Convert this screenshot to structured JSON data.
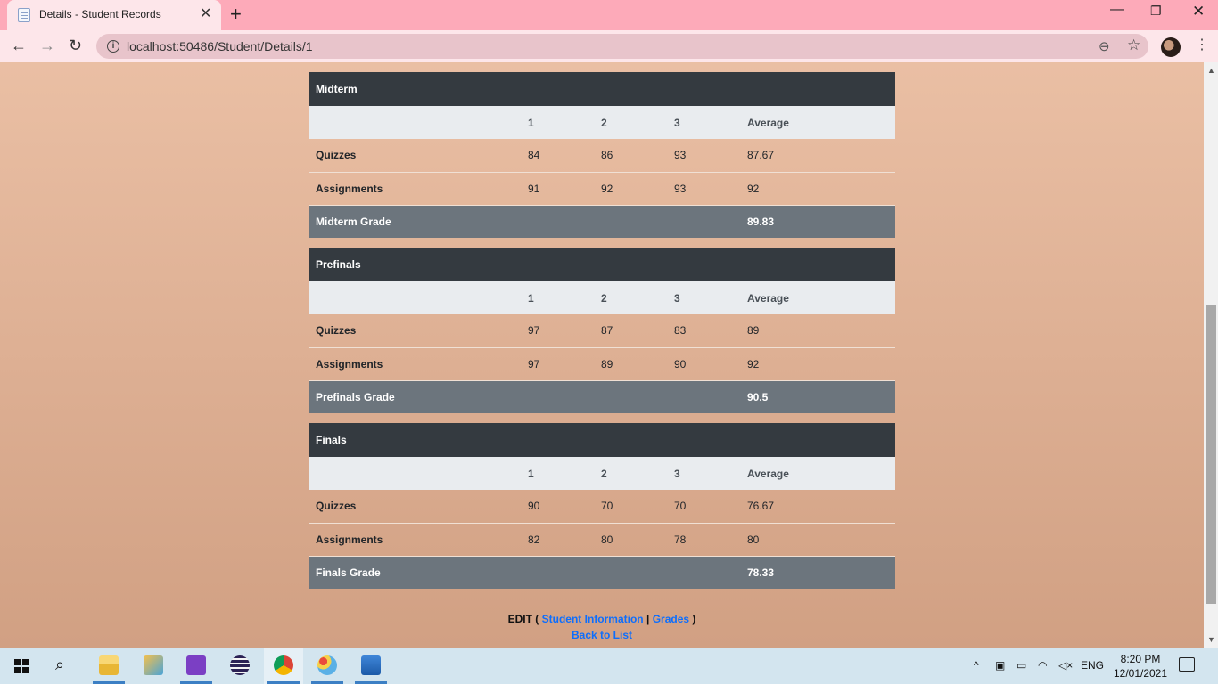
{
  "browser": {
    "tab_title": "Details - Student Records",
    "tab_close": "✕",
    "new_tab": "+",
    "url": "localhost:50486/Student/Details/1",
    "win_minimize": "—",
    "win_restore": "❐",
    "win_close": "✕",
    "back": "←",
    "forward": "→",
    "reload": "↻",
    "info": "i",
    "zoom": "⊖",
    "bookmark": "☆",
    "menu": "⋮"
  },
  "tables": [
    {
      "title": "Midterm",
      "columns": [
        "",
        "1",
        "2",
        "3",
        "Average"
      ],
      "rows": [
        {
          "label": "Quizzes",
          "values": [
            "84",
            "86",
            "93",
            "87.67"
          ]
        },
        {
          "label": "Assignments",
          "values": [
            "91",
            "92",
            "93",
            "92"
          ]
        }
      ],
      "footer_label": "Midterm Grade",
      "footer_value": "89.83"
    },
    {
      "title": "Prefinals",
      "columns": [
        "",
        "1",
        "2",
        "3",
        "Average"
      ],
      "rows": [
        {
          "label": "Quizzes",
          "values": [
            "97",
            "87",
            "83",
            "89"
          ]
        },
        {
          "label": "Assignments",
          "values": [
            "97",
            "89",
            "90",
            "92"
          ]
        }
      ],
      "footer_label": "Prefinals Grade",
      "footer_value": "90.5"
    },
    {
      "title": "Finals",
      "columns": [
        "",
        "1",
        "2",
        "3",
        "Average"
      ],
      "rows": [
        {
          "label": "Quizzes",
          "values": [
            "90",
            "70",
            "70",
            "76.67"
          ]
        },
        {
          "label": "Assignments",
          "values": [
            "82",
            "80",
            "78",
            "80"
          ]
        }
      ],
      "footer_label": "Finals Grade",
      "footer_value": "78.33"
    }
  ],
  "links": {
    "edit_label": "EDIT",
    "open_paren": "(",
    "student_info": "Student Information",
    "separator": "|",
    "grades": "Grades",
    "close_paren": ")",
    "back_to_list": "Back to List"
  },
  "taskbar": {
    "apps": [
      "file-explorer-icon",
      "network-tool-icon",
      "visual-studio-icon",
      "eclipse-icon",
      "chrome-icon",
      "paint-icon",
      "photos-icon"
    ],
    "language": "ENG",
    "time": "8:20 PM",
    "date": "12/01/2021"
  },
  "colors": {
    "table_header": "#343a40",
    "table_columns": "#e9ecef",
    "table_footer": "#6c757d",
    "link": "#0d6efd",
    "tabbar": "#fdaab9"
  }
}
